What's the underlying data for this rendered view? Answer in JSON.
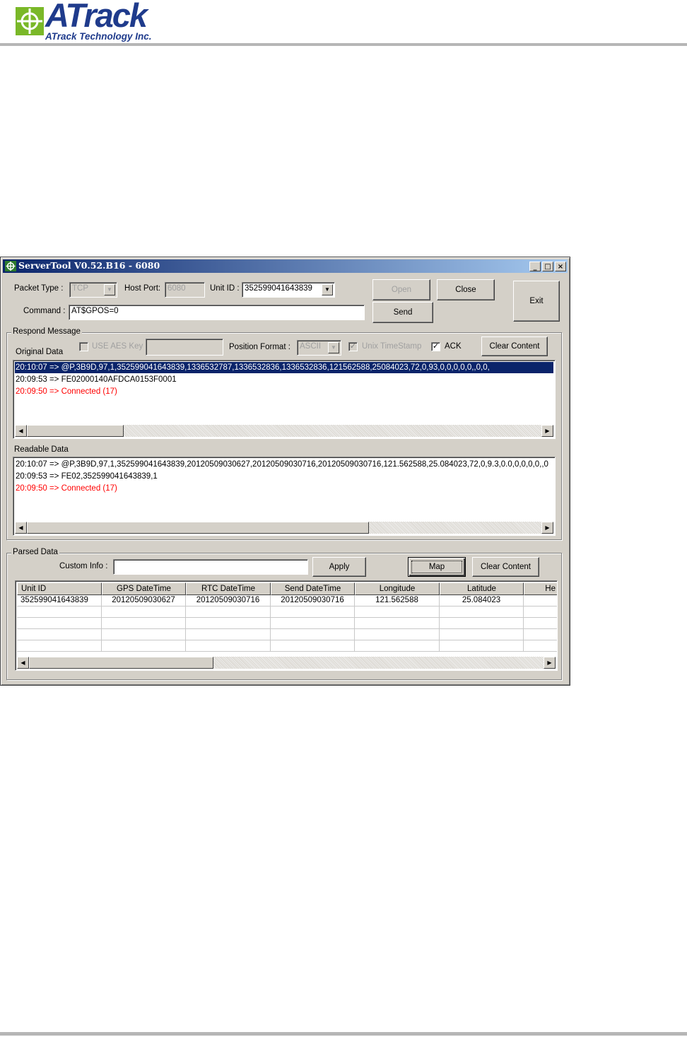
{
  "page": {
    "logo_name": "ATrack",
    "logo_tagline": "ATrack Technology Inc."
  },
  "window": {
    "title": "ServerTool V0.52.B16 - 6080",
    "controls": {
      "minimize": "_",
      "maximize": "□",
      "close": "×"
    }
  },
  "connection": {
    "packet_type_label": "Packet Type :",
    "packet_type_value": "TCP",
    "host_port_label": "Host Port:",
    "host_port_value": "6080",
    "unit_id_label": "Unit ID :",
    "unit_id_value": "352599041643839",
    "command_label": "Command :",
    "command_value": "AT$GPOS=0",
    "open_label": "Open",
    "close_label": "Close",
    "send_label": "Send",
    "exit_label": "Exit"
  },
  "respond": {
    "title": "Respond Message",
    "original_label": "Original Data",
    "use_aes_label": "USE AES Key",
    "aes_key_value": "",
    "position_format_label": "Position Format :",
    "position_format_value": "ASCII",
    "unix_timestamp_label": "Unix TimeStamp",
    "unix_timestamp_checked": true,
    "ack_label": "ACK",
    "ack_checked": true,
    "clear_label": "Clear Content",
    "original_lines": [
      "20:10:07 => @P,3B9D,97,1,352599041643839,1336532787,1336532836,1336532836,121562588,25084023,72,0,93,0,0,0,0,0,,0,0,",
      "20:09:53 => FE02000140AFDCA0153F0001",
      "20:09:50 => Connected (17)"
    ],
    "readable_label": "Readable Data",
    "readable_lines": [
      "20:10:07 => @P,3B9D,97,1,352599041643839,20120509030627,20120509030716,20120509030716,121.562588,25.084023,72,0,9.3,0.0,0,0,0,0,,0",
      "20:09:53 => FE02,352599041643839,1",
      "20:09:50 => Connected (17)"
    ]
  },
  "parsed": {
    "title": "Parsed Data",
    "custom_info_label": "Custom Info :",
    "custom_info_value": "",
    "apply_label": "Apply",
    "map_label": "Map",
    "clear_label": "Clear Content",
    "columns": [
      "Unit ID",
      "GPS DateTime",
      "RTC DateTime",
      "Send DateTime",
      "Longitude",
      "Latitude",
      "He"
    ],
    "rows": [
      [
        "352599041643839",
        "20120509030627",
        "20120509030716",
        "20120509030716",
        "121.562588",
        "25.084023",
        ""
      ]
    ]
  }
}
